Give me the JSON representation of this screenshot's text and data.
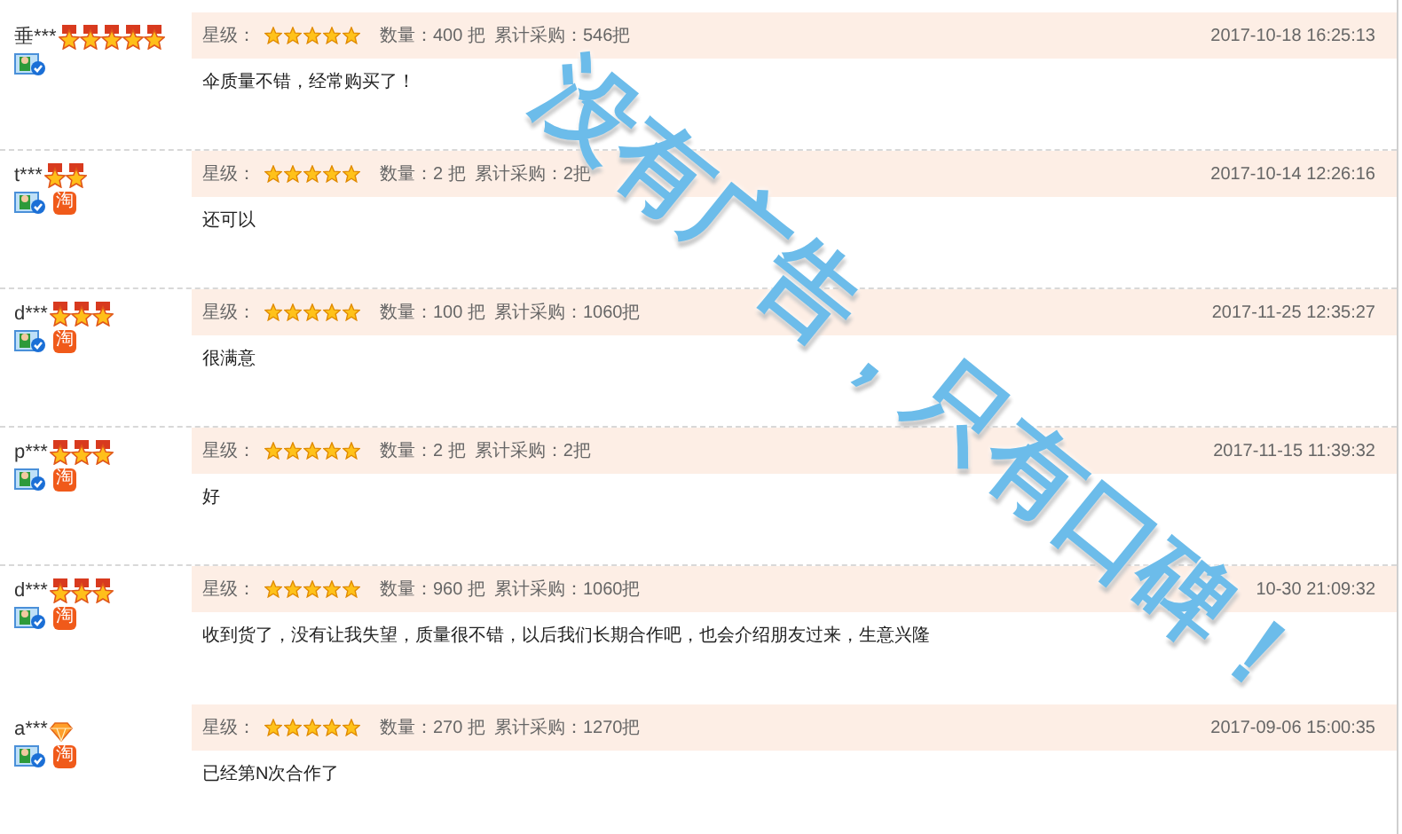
{
  "reviews": [
    {
      "user": "垂***",
      "badges": [
        {
          "kind": "medal"
        },
        {
          "kind": "medal"
        },
        {
          "kind": "medal"
        },
        {
          "kind": "medal"
        },
        {
          "kind": "medal"
        }
      ],
      "verified": true,
      "rating_label": "星级：",
      "stars": 5,
      "quantity": "数量：400 把",
      "total": "累计采购：546把",
      "time": "2017-10-18 16:25:13",
      "comment": "伞质量不错，经常购买了！",
      "divider_below": true
    },
    {
      "user": "t***",
      "badges": [
        {
          "kind": "medal"
        },
        {
          "kind": "medal"
        }
      ],
      "verified": true,
      "taobao": "淘",
      "rating_label": "星级：",
      "stars": 5,
      "quantity": "数量：2 把",
      "total": "累计采购：2把",
      "time": "2017-10-14 12:26:16",
      "comment": "还可以",
      "divider_below": true
    },
    {
      "user": "d***",
      "badges": [
        {
          "kind": "medal"
        },
        {
          "kind": "medal"
        },
        {
          "kind": "medal"
        }
      ],
      "verified": true,
      "taobao": "淘",
      "rating_label": "星级：",
      "stars": 5,
      "quantity": "数量：100 把",
      "total": "累计采购：1060把",
      "time": "2017-11-25 12:35:27",
      "comment": "很满意",
      "divider_below": true
    },
    {
      "user": "p***",
      "badges": [
        {
          "kind": "medal"
        },
        {
          "kind": "medal"
        },
        {
          "kind": "medal"
        }
      ],
      "verified": true,
      "taobao": "淘",
      "rating_label": "星级：",
      "stars": 5,
      "quantity": "数量：2 把",
      "total": "累计采购：2把",
      "time": "2017-11-15 11:39:32",
      "comment": "好",
      "divider_below": true
    },
    {
      "user": "d***",
      "badges": [
        {
          "kind": "medal"
        },
        {
          "kind": "medal"
        },
        {
          "kind": "medal"
        }
      ],
      "verified": true,
      "taobao": "淘",
      "rating_label": "星级：",
      "stars": 5,
      "quantity": "数量：960 把",
      "total": "累计采购：1060把",
      "time": "10-30 21:09:32",
      "comment": "收到货了，没有让我失望，质量很不错，以后我们长期合作吧，也会介绍朋友过来，生意兴隆",
      "divider_below": false
    },
    {
      "user": "a***",
      "badges": [
        {
          "kind": "diamond"
        }
      ],
      "verified": true,
      "taobao": "淘",
      "rating_label": "星级：",
      "stars": 5,
      "quantity": "数量：270 把",
      "total": "累计采购：1270把",
      "time": "2017-09-06 15:00:35",
      "comment": "已经第N次合作了",
      "divider_below": false
    }
  ],
  "slogan": "没有广告，只有口碑！"
}
